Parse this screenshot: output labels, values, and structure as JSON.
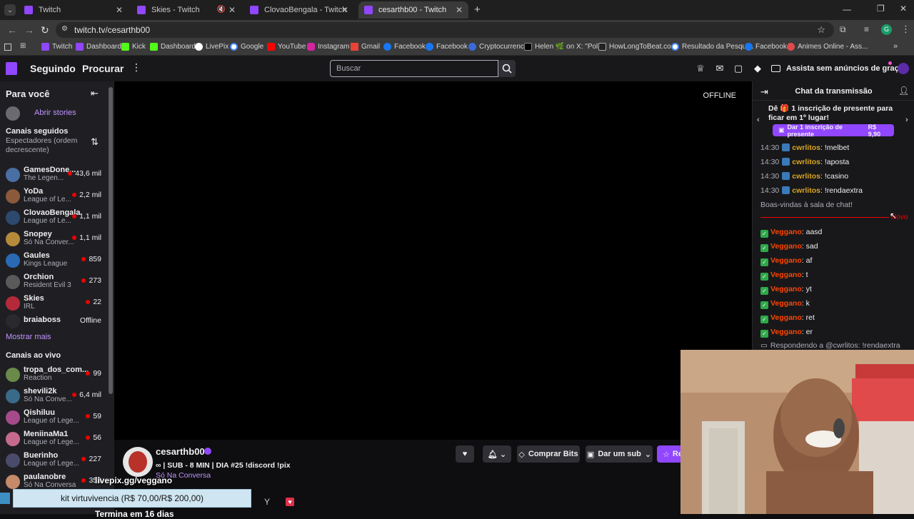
{
  "browser": {
    "tabs": [
      {
        "title": "Twitch",
        "active": false
      },
      {
        "title": "Skies - Twitch",
        "active": false
      },
      {
        "title": "ClovaoBengala - Twitch",
        "active": false
      },
      {
        "title": "cesarthb00 - Twitch",
        "active": true
      }
    ],
    "new_tab": "+",
    "url": "twitch.tv/cesarthb00",
    "bookmarks": [
      "Twitch",
      "Dashboard",
      "Kick",
      "Dashboard",
      "LivePix",
      "Google",
      "YouTube",
      "Instagram",
      "Gmail",
      "Facebook",
      "Facebook",
      "Cryptocurrency",
      "Helen 🌿 on X: \"Pol...",
      "HowLongToBeat.co...",
      "Resultado da Pesqui...",
      "Facebook",
      "Animes Online - Ass..."
    ]
  },
  "topnav": {
    "following": "Seguindo",
    "browse": "Procurar",
    "search_placeholder": "Buscar",
    "promo": "Assista sem anúncios de graça"
  },
  "sidebar": {
    "title": "Para você",
    "stories": "Abrir stories",
    "followed_title": "Canais seguidos",
    "sort_label": "Espectadores (ordem decrescente)",
    "followed": [
      {
        "name": "GamesDone...",
        "game": "The Legen...",
        "viewers": "43,6 mil",
        "color": "#4a6fa5"
      },
      {
        "name": "YoDa",
        "game": "League of Le...",
        "viewers": "2,2 mil",
        "color": "#8a5a3a"
      },
      {
        "name": "ClovaoBengala",
        "game": "League of Le...",
        "viewers": "1,1 mil",
        "color": "#2d4a6e"
      },
      {
        "name": "Snopey",
        "game": "Só Na Conver...",
        "viewers": "1,1 mil",
        "color": "#b58a3a"
      },
      {
        "name": "Gaules",
        "game": "Kings League",
        "viewers": "859",
        "color": "#2a6ab5"
      },
      {
        "name": "Orchion",
        "game": "Resident Evil 3",
        "viewers": "273",
        "color": "#5a5a5a"
      },
      {
        "name": "Skies",
        "game": "IRL",
        "viewers": "22",
        "color": "#b52a3a"
      }
    ],
    "offline_channel": {
      "name": "braiaboss",
      "status": "Offline"
    },
    "show_more": "Mostrar mais",
    "live_title": "Canais ao vivo",
    "live": [
      {
        "name": "tropa_dos_com...",
        "game": "Reaction",
        "viewers": "99",
        "color": "#6a8a4a"
      },
      {
        "name": "shevili2k",
        "game": "Só Na Conve...",
        "viewers": "6,4 mil",
        "color": "#3a6a8a"
      },
      {
        "name": "Qishiluu",
        "game": "League of Lege...",
        "viewers": "59",
        "color": "#a54a8a"
      },
      {
        "name": "MeniinaMa1",
        "game": "League of Lege...",
        "viewers": "56",
        "color": "#c56a8a"
      },
      {
        "name": "Buerinho",
        "game": "League of Lege...",
        "viewers": "227",
        "color": "#4a4a6a"
      },
      {
        "name": "paulanobre",
        "game": "Só Na Conversa",
        "viewers": "353",
        "color": "#c58a6a"
      }
    ]
  },
  "player": {
    "status": "OFFLINE"
  },
  "channel": {
    "name": "cesarthb00",
    "title": "∞ | SUB - 8 MIN | DIA #25 !discord !pix",
    "category": "Só Na Conversa",
    "buy_bits": "Comprar Bits",
    "gift_sub": "Dar um sub",
    "subscribe_partial": "Re"
  },
  "overlay": {
    "livepix": "livepix.gg/veggano",
    "kit": "kit virtuvivencia (R$ 70,00/R$ 200,00)",
    "bottom_text": "Termina em 16 dias"
  },
  "chat": {
    "title": "Chat da transmissão",
    "gift_banner": "Dê 🎁 1 inscrição de presente para ficar em 1º lugar!",
    "gift_button": "Dar 1 inscrição de presente",
    "gift_price": "R$ 9,90",
    "messages": [
      {
        "time": "14:30",
        "user": "cwrlitos",
        "text": "!melbet",
        "color": "#daa520"
      },
      {
        "time": "14:30",
        "user": "cwrlitos",
        "text": "!aposta",
        "color": "#daa520"
      },
      {
        "time": "14:30",
        "user": "cwrlitos",
        "text": "!casino",
        "color": "#daa520"
      },
      {
        "time": "14:30",
        "user": "cwrlitos",
        "text": "!rendaextra",
        "color": "#daa520"
      }
    ],
    "welcome": "Boas-vindas à sala de chat!",
    "new_label": "Novo",
    "new_messages": [
      {
        "user": "Veggano",
        "text": "aasd"
      },
      {
        "user": "Veggano",
        "text": "sad"
      },
      {
        "user": "Veggano",
        "text": "af"
      },
      {
        "user": "Veggano",
        "text": "t"
      },
      {
        "user": "Veggano",
        "text": "yt"
      },
      {
        "user": "Veggano",
        "text": "k"
      },
      {
        "user": "Veggano",
        "text": "ret"
      },
      {
        "user": "Veggano",
        "text": "er"
      }
    ],
    "new_user_color": "#ff4500",
    "reply": "Respondendo a @cwrlitos: !rendaextra"
  },
  "colors": {
    "accent": "#9146ff",
    "live": "#eb0400",
    "bg": "#0e0e10"
  }
}
